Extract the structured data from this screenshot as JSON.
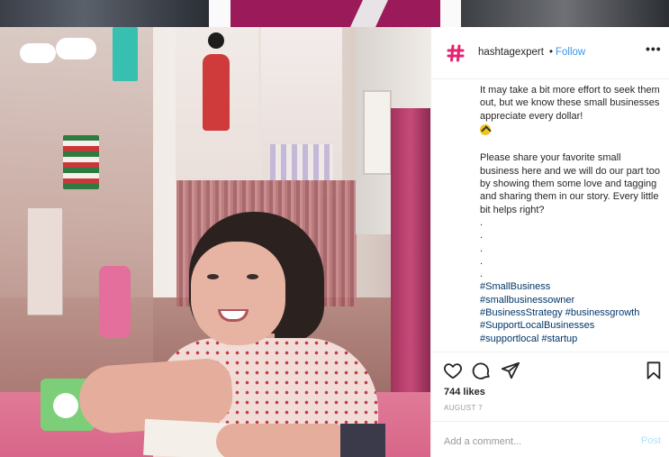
{
  "post": {
    "username": "hashtagexpert",
    "separator": "•",
    "follow_label": "Follow",
    "more_label": "•••",
    "caption_lines": [
      "It may take a bit more effort to seek them out, but we know these small businesses appreciate every dollar!"
    ],
    "caption_para2": "Please share your favorite small business here and we will do our part too by showing them some love and tagging and sharing them in our story. Every little bit helps right?",
    "dots": [
      ".",
      ".",
      ".",
      ".",
      "."
    ],
    "hashtags": [
      "#SmallBusiness",
      "#smallbusinessowner",
      "#BusinessStrategy #businessgrowth",
      "#SupportLocalBusinesses",
      "#supportlocal #startup"
    ],
    "likes": "744 likes",
    "date": "AUGUST 7",
    "comment_placeholder": "Add a comment...",
    "post_label": "Post"
  },
  "icons": {
    "avatar": "hashtag-logo-icon",
    "like": "heart-icon",
    "comment": "comment-icon",
    "share": "share-icon",
    "save": "bookmark-icon",
    "caption_emoji": "bee-emoji-icon"
  },
  "colors": {
    "brand": "#e4246f",
    "link": "#3897f0",
    "hashtag": "#003569",
    "text": "#262626",
    "muted": "#999999"
  }
}
